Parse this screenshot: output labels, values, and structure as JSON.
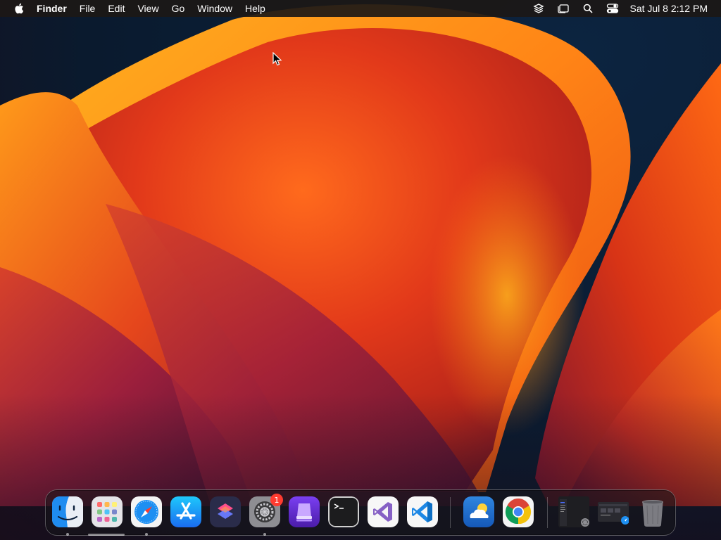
{
  "menubar": {
    "app_name": "Finder",
    "menus": [
      "File",
      "Edit",
      "View",
      "Go",
      "Window",
      "Help"
    ],
    "status_icons": [
      "stack-icon",
      "stage-manager-icon",
      "spotlight-search-icon",
      "control-center-icon"
    ],
    "clock": "Sat Jul 8  2:12 PM"
  },
  "dock": {
    "apps": [
      {
        "name": "Finder",
        "icon": "finder-icon",
        "running": true
      },
      {
        "name": "Launchpad",
        "icon": "launchpad-icon",
        "running": false
      },
      {
        "name": "Safari",
        "icon": "safari-icon",
        "running": true
      },
      {
        "name": "App Store",
        "icon": "app-store-icon",
        "running": false
      },
      {
        "name": "Shortcuts",
        "icon": "shortcuts-icon",
        "running": false
      },
      {
        "name": "System Settings",
        "icon": "system-settings-icon",
        "running": true,
        "badge": "1"
      },
      {
        "name": "Apple Configurator",
        "icon": "apple-configurator-icon",
        "running": false
      },
      {
        "name": "Terminal",
        "icon": "terminal-icon",
        "running": false
      },
      {
        "name": "Visual Studio",
        "icon": "visual-studio-icon",
        "running": false
      },
      {
        "name": "Visual Studio Code",
        "icon": "vscode-icon",
        "running": false
      }
    ],
    "recent_apps": [
      {
        "name": "Weather",
        "icon": "weather-icon"
      },
      {
        "name": "Google Chrome",
        "icon": "chrome-icon"
      }
    ],
    "minimized_windows": [
      {
        "name": "Minimized Window 1",
        "icon": "minimized-window-icon"
      },
      {
        "name": "Minimized Window 2",
        "icon": "minimized-window-icon"
      }
    ],
    "trash": {
      "name": "Trash",
      "icon": "trash-icon"
    }
  }
}
